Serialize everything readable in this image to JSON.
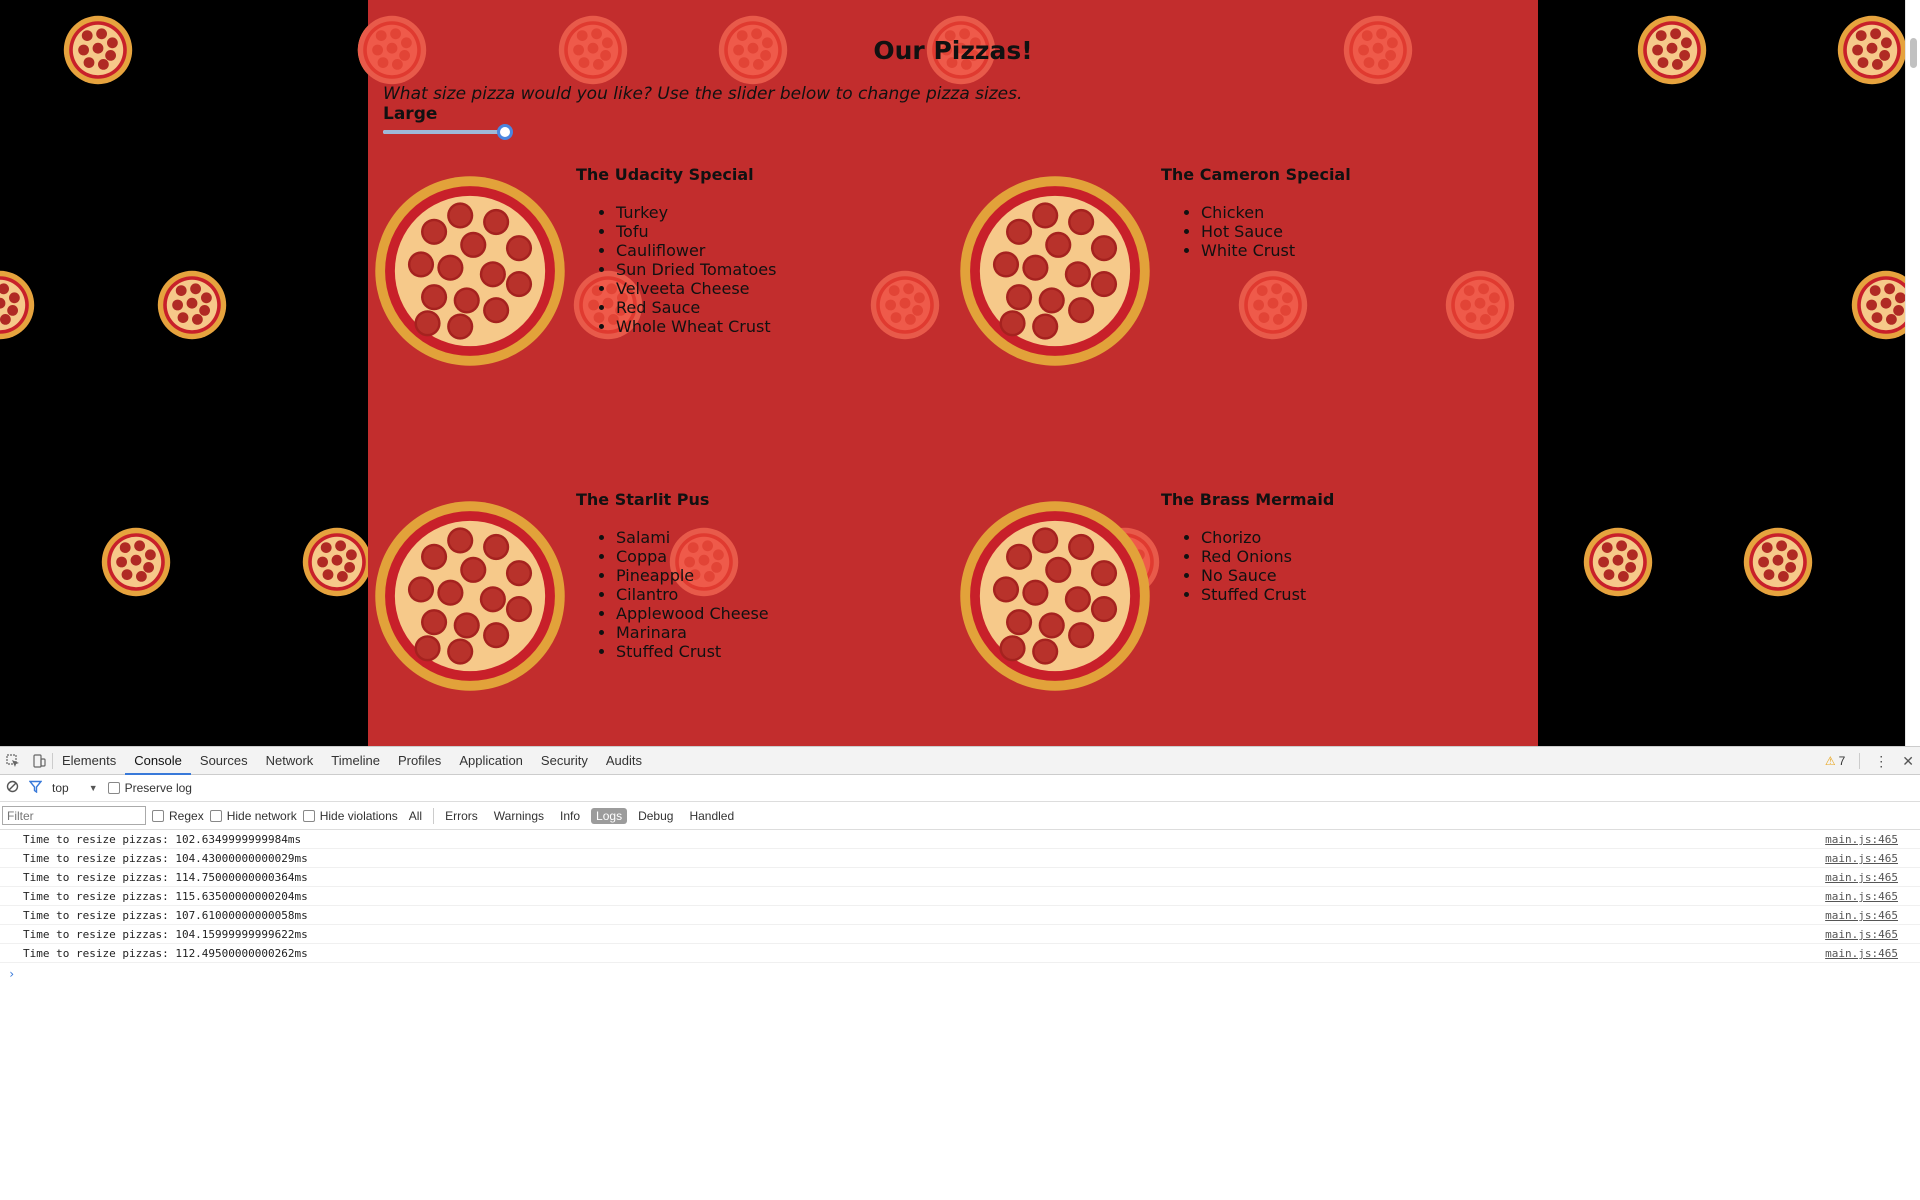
{
  "page": {
    "title": "Our Pizzas!",
    "size_question": "What size pizza would you like? Use the slider below to change pizza sizes.",
    "size_label": "Large",
    "slider_value": 1.0
  },
  "pizzas": [
    {
      "name": "The Udacity Special",
      "toppings": [
        "Turkey",
        "Tofu",
        "Cauliflower",
        "Sun Dried Tomatoes",
        "Velveeta Cheese",
        "Red Sauce",
        "Whole Wheat Crust"
      ]
    },
    {
      "name": "The Cameron Special",
      "toppings": [
        "Chicken",
        "Hot Sauce",
        "White Crust"
      ]
    },
    {
      "name": "The Starlit Pus",
      "toppings": [
        "Salami",
        "Coppa",
        "Pineapple",
        "Cilantro",
        "Applewood Cheese",
        "Marinara",
        "Stuffed Crust"
      ]
    },
    {
      "name": "The Brass Mermaid",
      "toppings": [
        "Chorizo",
        "Red Onions",
        "No Sauce",
        "Stuffed Crust"
      ]
    }
  ],
  "devtools": {
    "tabs": [
      "Elements",
      "Console",
      "Sources",
      "Network",
      "Timeline",
      "Profiles",
      "Application",
      "Security",
      "Audits"
    ],
    "active_tab": "Console",
    "warning_count": "7",
    "context": "top",
    "preserve_log": "Preserve log",
    "filter_placeholder": "Filter",
    "regex": "Regex",
    "hide_network": "Hide network",
    "hide_violations": "Hide violations",
    "levels": [
      "All",
      "Errors",
      "Warnings",
      "Info",
      "Logs",
      "Debug",
      "Handled"
    ],
    "active_level": "Logs",
    "prompt": "›",
    "logs": [
      {
        "text": "Time to resize pizzas: 102.6349999999984ms",
        "source": "main.js:465"
      },
      {
        "text": "Time to resize pizzas: 104.43000000000029ms",
        "source": "main.js:465"
      },
      {
        "text": "Time to resize pizzas: 114.75000000000364ms",
        "source": "main.js:465"
      },
      {
        "text": "Time to resize pizzas: 115.63500000000204ms",
        "source": "main.js:465"
      },
      {
        "text": "Time to resize pizzas: 107.61000000000058ms",
        "source": "main.js:465"
      },
      {
        "text": "Time to resize pizzas: 104.15999999999622ms",
        "source": "main.js:465"
      },
      {
        "text": "Time to resize pizzas: 112.49500000000262ms",
        "source": "main.js:465"
      }
    ]
  },
  "colors": {
    "container_bg": "#c22d2d",
    "page_bg": "#000000",
    "accent": "#3879d9"
  },
  "icons": {
    "inspect": "inspect-element-icon",
    "device": "device-mode-icon",
    "clear": "clear-console-icon",
    "filter": "filter-icon",
    "more": "more-vertical-icon",
    "close": "close-icon",
    "warning": "warning-icon"
  }
}
